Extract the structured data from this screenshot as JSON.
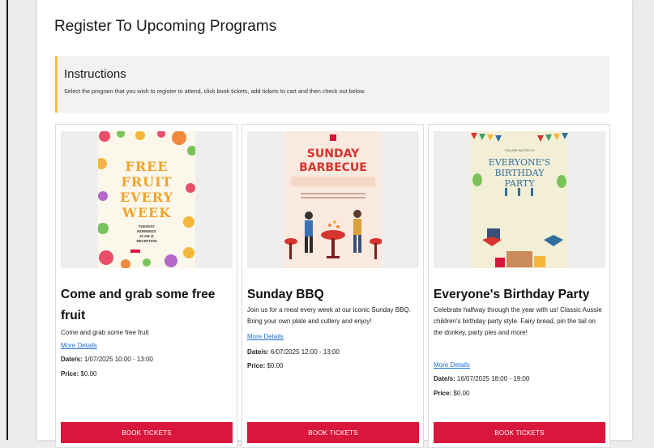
{
  "page": {
    "title": "Register To Upcoming Programs"
  },
  "instructions": {
    "title": "Instructions",
    "text": "Select the program that you wish to register to attend, click book tickets, add tickets to cart and then check out below."
  },
  "labels": {
    "more_details": "More Details",
    "dates_label": "Date/s:",
    "price_label": "Price:",
    "book_tickets": "BOOK TICKETS"
  },
  "programs": [
    {
      "title": "Come and grab some free fruit",
      "description": "Come and grab some free fruit",
      "dates": "1/07/2025 10:00 - 13:00",
      "price": "$0.00",
      "poster": {
        "headline_lines": [
          "FREE",
          "FRUIT",
          "EVERY",
          "WEEK"
        ],
        "sub_lines": [
          "TUESDAY",
          "MORNINGS",
          "10 AM @",
          "RECEPTION"
        ],
        "accent_color": "#f2a32b"
      }
    },
    {
      "title": "Sunday BBQ",
      "description": "Join us for a meal every week at our iconic Sunday BBQ. Bring your own plate and cutlery and enjoy!",
      "dates": "6/07/2025 12:00 - 13:00",
      "price": "$0.00",
      "poster": {
        "headline_lines": [
          "SUNDAY",
          "BARBECUE"
        ],
        "accent_color": "#d7342f"
      }
    },
    {
      "title": "Everyone's Birthday Party",
      "description": "Celebrate halfway through the year with us! Classic Aussie children's birthday party style. Fairy bread, pin the tail on the donkey, party pies and more!",
      "dates": "16/07/2025 18:00 - 19:00",
      "price": "$0.00",
      "poster": {
        "kicker": "YOU ARE INVITED TO",
        "headline_lines": [
          "EVERYONE'S",
          "BIRTHDAY",
          "PARTY"
        ],
        "accent_color": "#2f6e9e"
      }
    }
  ],
  "colors": {
    "button_bg": "#d9163c",
    "link": "#1f6fd1",
    "instructions_accent": "#f2c230"
  }
}
